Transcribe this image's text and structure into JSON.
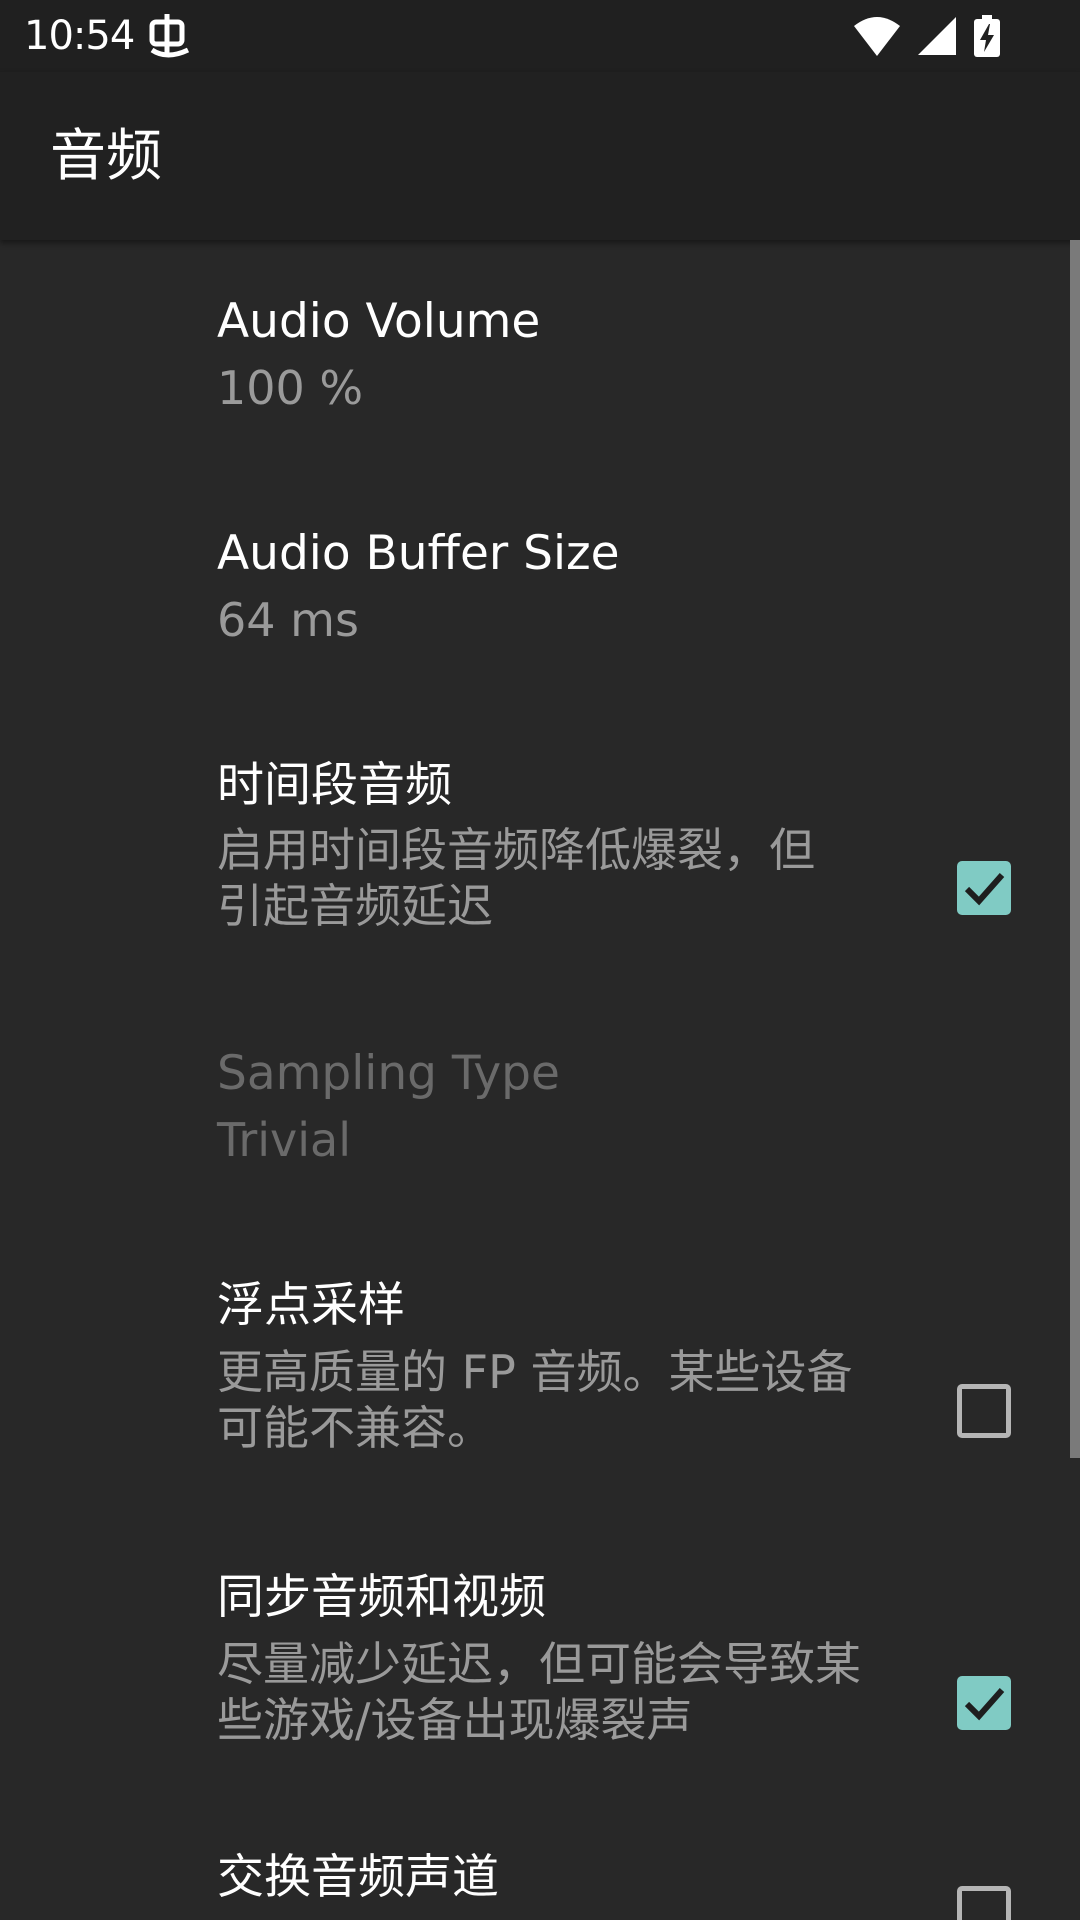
{
  "status_bar": {
    "time": "10:54",
    "icons": [
      "notification-icon",
      "wifi-icon",
      "cell-signal-icon",
      "battery-charging-icon"
    ]
  },
  "app_bar": {
    "title": "音频"
  },
  "preferences": [
    {
      "title": "Audio Volume",
      "summary": "100 %",
      "enabled": true
    },
    {
      "title": "Audio Buffer Size",
      "summary": "64 ms",
      "enabled": true
    },
    {
      "title": "时间段音频",
      "summary": "启用时间段音频降低爆裂，但引起音频延迟",
      "checked": true,
      "enabled": true
    },
    {
      "title": "Sampling Type",
      "summary": "Trivial",
      "enabled": false
    },
    {
      "title": "浮点采样",
      "summary": "更高质量的 FP 音频。某些设备可能不兼容。",
      "checked": false,
      "enabled": true
    },
    {
      "title": "同步音频和视频",
      "summary": "尽量减少延迟，但可能会导致某些游戏/设备出现爆裂声",
      "checked": true,
      "enabled": true
    },
    {
      "title": "交换音频声道",
      "checked": false,
      "enabled": true
    }
  ],
  "colors": {
    "background": "#282828",
    "app_bar": "#212121",
    "status_bar": "#202020",
    "accent": "#80cbc4",
    "title_text": "#ffffff",
    "summary_text": "#9a9a9a",
    "disabled_text": "#6a6a6a"
  }
}
